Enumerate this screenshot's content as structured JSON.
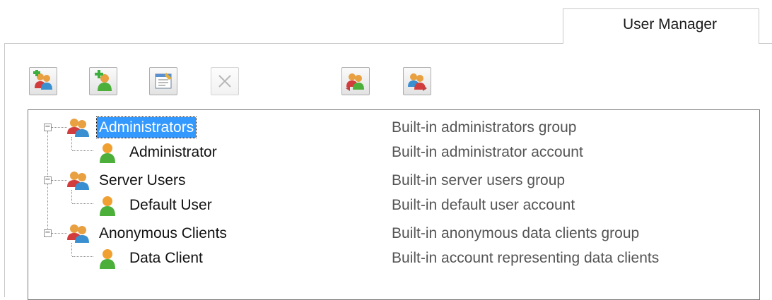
{
  "tab": {
    "label": "User Manager"
  },
  "toolbar": {
    "buttons": [
      {
        "name": "add-group-button",
        "icon": "add-group-icon",
        "enabled": true
      },
      {
        "name": "add-user-button",
        "icon": "add-user-icon",
        "enabled": true
      },
      {
        "name": "properties-button",
        "icon": "properties-icon",
        "enabled": true
      },
      {
        "name": "delete-button",
        "icon": "delete-icon",
        "enabled": false
      },
      {
        "name": "move-to-group-button",
        "icon": "user-group-arrow-icon",
        "enabled": true
      },
      {
        "name": "move-from-group-button",
        "icon": "user-group-arrow-out-icon",
        "enabled": true
      }
    ]
  },
  "tree": {
    "groups": [
      {
        "label": "Administrators",
        "description": "Built-in administrators group",
        "selected": true,
        "child": {
          "label": "Administrator",
          "description": "Built-in administrator account"
        }
      },
      {
        "label": "Server Users",
        "description": "Built-in server users group",
        "selected": false,
        "child": {
          "label": "Default User",
          "description": "Built-in default user account"
        }
      },
      {
        "label": "Anonymous Clients",
        "description": "Built-in anonymous data clients group",
        "selected": false,
        "child": {
          "label": "Data Client",
          "description": "Built-in account representing data clients"
        }
      }
    ]
  },
  "colors": {
    "selection": "#3399ff",
    "user_green": "#4caf3a",
    "user_orange": "#f0a030",
    "group_red": "#d23c3c"
  }
}
